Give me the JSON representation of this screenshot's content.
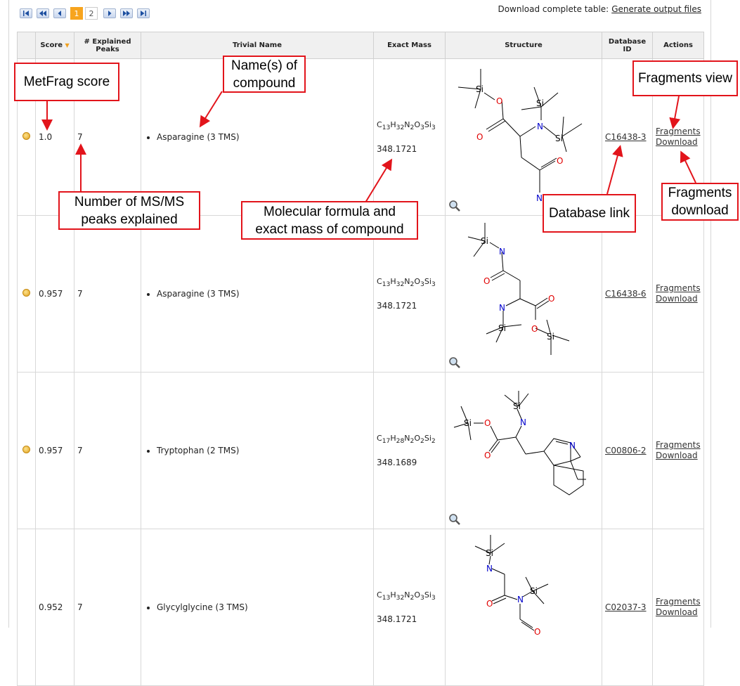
{
  "pager": {
    "first": "first-page",
    "prev_fast": "fast-rewind",
    "prev": "previous",
    "pages": [
      "1",
      "2"
    ],
    "current_page": "1",
    "next": "next",
    "next_fast": "fast-forward",
    "last": "last-page"
  },
  "download": {
    "label": "Download complete table:",
    "link": "Generate output files"
  },
  "table": {
    "headers": {
      "score": "Score",
      "explained": "# Explained Peaks",
      "trivial": "Trivial Name",
      "mass": "Exact Mass",
      "structure": "Structure",
      "dbid": "Database ID",
      "actions": "Actions"
    },
    "rows": [
      {
        "score": "1.0",
        "peaks": "7",
        "name": "Asparagine (3 TMS)",
        "formula": "C13H32N2O3Si3",
        "mass": "348.1721",
        "dbid": "C16438-3",
        "fragments": "Fragments",
        "download": "Download"
      },
      {
        "score": "0.957",
        "peaks": "7",
        "name": "Asparagine (3 TMS)",
        "formula": "C13H32N2O3Si3",
        "mass": "348.1721",
        "dbid": "C16438-6",
        "fragments": "Fragments",
        "download": "Download"
      },
      {
        "score": "0.957",
        "peaks": "7",
        "name": "Tryptophan (2 TMS)",
        "formula": "C17H28N2O2Si2",
        "mass": "348.1689",
        "dbid": "C00806-2",
        "fragments": "Fragments",
        "download": "Download"
      },
      {
        "score": "0.952",
        "peaks": "7",
        "name": "Glycylglycine (3 TMS)",
        "formula": "C13H32N2O3Si3",
        "mass": "348.1721",
        "dbid": "C02037-3",
        "fragments": "Fragments",
        "download": "Download"
      }
    ]
  },
  "callouts": {
    "metfrag": "MetFrag score",
    "names": "Name(s) of compound",
    "peaks": "Number of MS/MS peaks explained",
    "formula": "Molecular formula and exact mass of compound",
    "dblink": "Database link",
    "fragview": "Fragments view",
    "fragdl": "Fragments download"
  },
  "colors": {
    "accent": "#f7a41d",
    "callout_border": "#e2141b",
    "oxygen": "#e00000",
    "nitrogen": "#0000cc"
  }
}
